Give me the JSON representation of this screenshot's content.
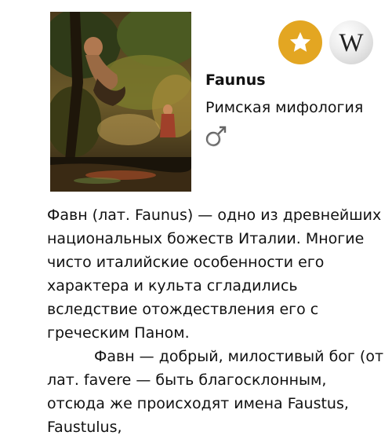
{
  "article": {
    "title": "Faunus",
    "subtitle": "Римская мифология",
    "image_alt": "painting-faun",
    "gender_icon": "male-symbol-icon",
    "paragraph_1": "Фавн (лат. Faunus) — одно из древнейших национальных божеств Италии. Многие чисто италийские особенности его характера и культа сгладились вследствие отождествления его с греческим Паном.",
    "paragraph_2": "Фавн — добрый, милостивый бог (от лат. favere — быть благосклонным, отсюда же происходят имена Faustus, Faustulus,"
  },
  "actions": {
    "favorite_icon": "star-icon",
    "favorite_color": "#e3a622",
    "wiki_label": "W"
  }
}
